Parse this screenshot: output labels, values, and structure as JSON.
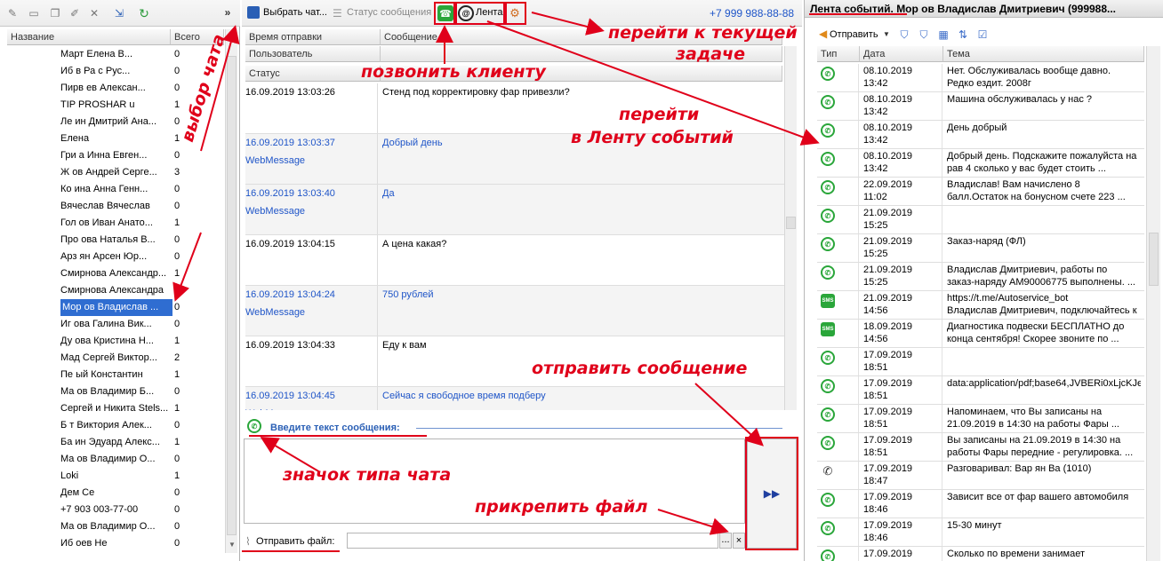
{
  "left": {
    "columns": [
      "Название",
      "Всего"
    ],
    "collapse_label": "»",
    "items": [
      {
        "name": "Март       Елена В...",
        "count": "0"
      },
      {
        "name": "Иб    в Ра   с Рус...",
        "count": "0"
      },
      {
        "name": "Пирв      ев Алексан...",
        "count": "0"
      },
      {
        "name": "TIP PROSHAR        u",
        "count": "1"
      },
      {
        "name": "Ле     ин Дмитрий Ана...",
        "count": "0"
      },
      {
        "name": "Елена",
        "count": "1"
      },
      {
        "name": "Гри      а Инна Евген...",
        "count": "0"
      },
      {
        "name": "Ж    ов Андрей Серге...",
        "count": "3"
      },
      {
        "name": "Ко       ина Анна Генн...",
        "count": "0"
      },
      {
        "name": "Вячеслав Вячеслав",
        "count": "0"
      },
      {
        "name": "Гол      ов Иван Анато...",
        "count": "1"
      },
      {
        "name": "Про      ова Наталья В...",
        "count": "0"
      },
      {
        "name": "Арз       ян Арсен Юр...",
        "count": "0"
      },
      {
        "name": "Смирнова Александр...",
        "count": "1"
      },
      {
        "name": "Смирнова Александра",
        "count": "1"
      },
      {
        "name": "Мор     ов Владислав ...",
        "count": "0",
        "selected": true
      },
      {
        "name": "Иг      ова Галина Вик...",
        "count": "0"
      },
      {
        "name": "Ду      ова Кристина Н...",
        "count": "1"
      },
      {
        "name": "Мад     Сергей Виктор...",
        "count": "2"
      },
      {
        "name": "Пе     ый Константин",
        "count": "1"
      },
      {
        "name": "Ма      ов Владимир Б...",
        "count": "0"
      },
      {
        "name": "Сергей и Никита Stels...",
        "count": "1"
      },
      {
        "name": "Б     т Виктория Алек...",
        "count": "0"
      },
      {
        "name": "Ба     ин Эдуард Алекс...",
        "count": "1"
      },
      {
        "name": "Ма      ов Владимир О...",
        "count": "0"
      },
      {
        "name": "Loki",
        "count": "1"
      },
      {
        "name": "Дем      Се",
        "count": "0"
      },
      {
        "name": "+7 903 003-77-00",
        "count": "0"
      },
      {
        "name": "Ма      ов Владимир О...",
        "count": "0"
      },
      {
        "name": "Иб         оев Не",
        "count": "0"
      }
    ]
  },
  "mid": {
    "toolbar": {
      "choose_chat": "Выбрать чат...",
      "message_status": "Статус сообщения",
      "feed": "Лента",
      "phone": "+7 999 988-88-88"
    },
    "columns": {
      "send_time": "Время отправки",
      "message": "Сообщение",
      "user": "Пользователь",
      "status": "Статус"
    },
    "messages": [
      {
        "time": "16.09.2019 13:03:26",
        "user": "",
        "text": "Стенд под корректировку фар привезли?",
        "blue": false
      },
      {
        "time": "16.09.2019 13:03:37",
        "user": "WebMessage",
        "text": "Добрый день",
        "blue": true
      },
      {
        "time": "16.09.2019 13:03:40",
        "user": "WebMessage",
        "text": "Да",
        "blue": true
      },
      {
        "time": "16.09.2019 13:04:15",
        "user": "",
        "text": "А цена какая?",
        "blue": false
      },
      {
        "time": "16.09.2019 13:04:24",
        "user": "WebMessage",
        "text": "750 рублей",
        "blue": true
      },
      {
        "time": "16.09.2019 13:04:33",
        "user": "",
        "text": "Еду к вам",
        "blue": false
      },
      {
        "time": "16.09.2019 13:04:45",
        "user": "WebMessage",
        "text": "Сейчас я свободное время подберу",
        "blue": true
      }
    ],
    "input_label": "Введите текст сообщения:",
    "attach_label": "Отправить файл:",
    "attach_browse": "...",
    "attach_clear": "×"
  },
  "right": {
    "title": "Лента событий. Мор     ов Владислав Дмитриевич (999988...",
    "send_label": "Отправить",
    "columns": [
      "Тип",
      "Дата",
      "Тема"
    ],
    "rows": [
      {
        "type": "whatsapp",
        "date": "08.10.2019",
        "time": "13:42",
        "s1": "Нет. Обслуживалась вообще давно.",
        "s2": "Редко ездит. 2008г"
      },
      {
        "type": "whatsapp",
        "date": "08.10.2019",
        "time": "13:42",
        "s1": "Машина обслуживалась у нас ?",
        "s2": ""
      },
      {
        "type": "whatsapp",
        "date": "08.10.2019",
        "time": "13:42",
        "s1": "День добрый",
        "s2": ""
      },
      {
        "type": "whatsapp",
        "date": "08.10.2019",
        "time": "13:42",
        "s1": "Добрый день. Подскажите пожалуйста на",
        "s2": "рав 4 сколько у вас будет стоить ..."
      },
      {
        "type": "whatsapp",
        "date": "22.09.2019",
        "time": "11:02",
        "s1": "Владислав! Вам начислено 8",
        "s2": "балл.Остаток на бонусном счете 223 ..."
      },
      {
        "type": "whatsapp",
        "date": "21.09.2019",
        "time": "15:25",
        "s1": "",
        "s2": ""
      },
      {
        "type": "whatsapp",
        "date": "21.09.2019",
        "time": "15:25",
        "s1": "Заказ-наряд (ФЛ)",
        "s2": ""
      },
      {
        "type": "whatsapp",
        "date": "21.09.2019",
        "time": "15:25",
        "s1": "Владислав Дмитриевич, работы по",
        "s2": "заказ-наряду АМ90006775 выполнены. ..."
      },
      {
        "type": "sms",
        "date": "21.09.2019",
        "time": "14:56",
        "s1": "https://t.me/Autoservice_bot",
        "s2": "Владислав Дмитриевич, подключайтесь к"
      },
      {
        "type": "sms",
        "date": "18.09.2019",
        "time": "14:56",
        "s1": "Диагностика подвески БЕСПЛАТНО до",
        "s2": "конца сентября! Скорее звоните по ..."
      },
      {
        "type": "whatsapp",
        "date": "17.09.2019",
        "time": "18:51",
        "s1": "",
        "s2": ""
      },
      {
        "type": "whatsapp",
        "date": "17.09.2019",
        "time": "18:51",
        "s1": "data:application/pdf;base64,JVBERi0xLjcKJe",
        "s2": ""
      },
      {
        "type": "whatsapp",
        "date": "17.09.2019",
        "time": "18:51",
        "s1": "Напоминаем, что Вы записаны на",
        "s2": "21.09.2019 в 14:30 на работы Фары ..."
      },
      {
        "type": "whatsapp",
        "date": "17.09.2019",
        "time": "18:51",
        "s1": "Вы записаны на 21.09.2019 в 14:30 на",
        "s2": "работы Фары передние - регулировка. ..."
      },
      {
        "type": "phone",
        "date": "17.09.2019",
        "time": "18:47",
        "s1": "Разговаривал: Вар      ян Ва          (1010)",
        "s2": ""
      },
      {
        "type": "whatsapp",
        "date": "17.09.2019",
        "time": "18:46",
        "s1": "Зависит все от фар вашего автомобиля",
        "s2": ""
      },
      {
        "type": "whatsapp",
        "date": "17.09.2019",
        "time": "18:46",
        "s1": "15-30 минут",
        "s2": ""
      },
      {
        "type": "whatsapp",
        "date": "17.09.2019",
        "time": "",
        "s1": "Сколько по времени занимает",
        "s2": ""
      }
    ]
  },
  "annotations": {
    "chat_select": "выбор чата",
    "call_client": "позвонить клиенту",
    "go_task_1": "перейти к текущей",
    "go_task_2": "задаче",
    "go_feed_1": "перейти",
    "go_feed_2": "в Ленту событий",
    "send_message": "отправить сообщение",
    "chat_type_icon": "значок типа чата",
    "attach_file": "прикрепить файл"
  },
  "colors": {
    "accent": "#2f6dd1",
    "annotation": "#e0001a",
    "whatsapp": "#2aa63a",
    "message_blue": "#1f55c8"
  }
}
